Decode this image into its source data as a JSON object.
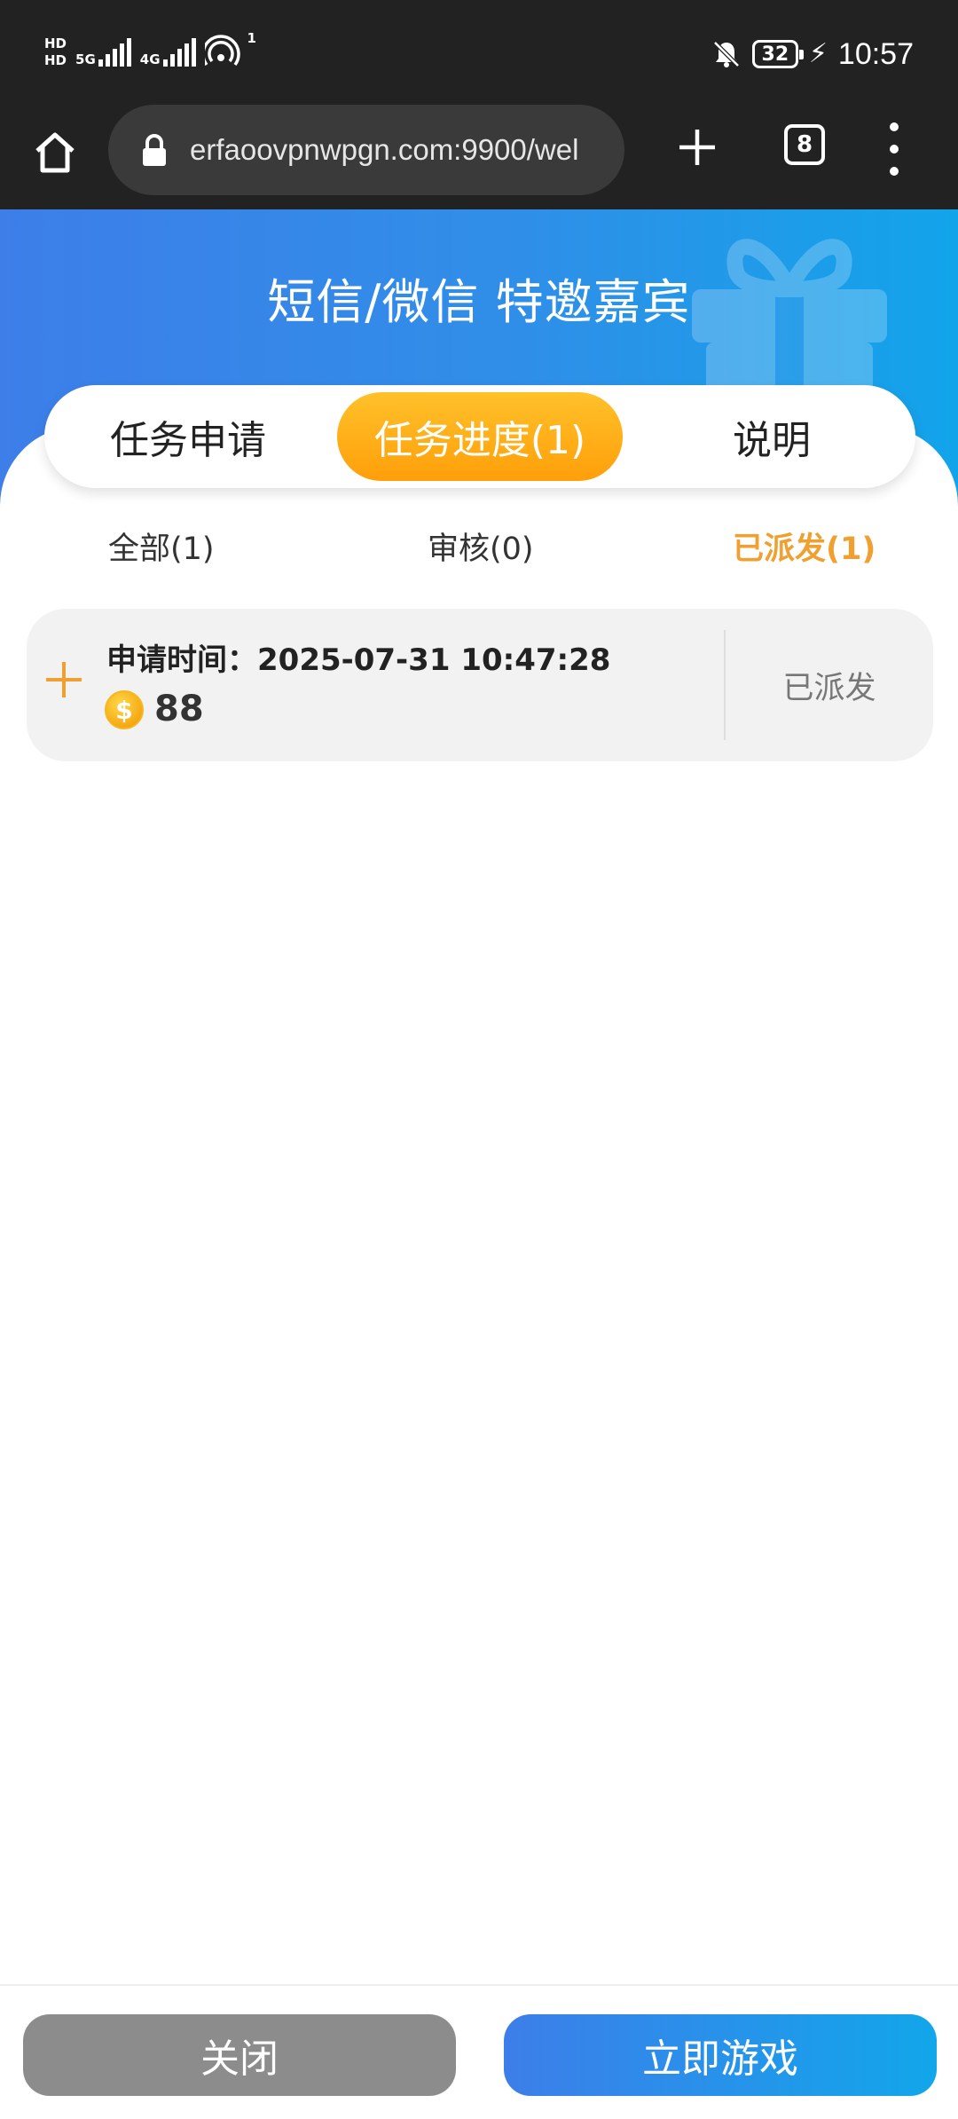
{
  "status_bar": {
    "hd_top": "HD",
    "hd_bottom": "HD",
    "net1": "5G",
    "net2": "4G",
    "hotspot_count": "1",
    "battery": "32",
    "time": "10:57"
  },
  "browser": {
    "url": "erfaoovpnwpgn.com:9900/wel",
    "tab_count": "8"
  },
  "hero": {
    "title": "短信/微信 特邀嘉宾"
  },
  "tabs": [
    {
      "label": "任务申请",
      "active": false
    },
    {
      "label": "任务进度(1)",
      "active": true
    },
    {
      "label": "说明",
      "active": false
    }
  ],
  "filters": [
    {
      "label": "全部(1)",
      "active": false
    },
    {
      "label": "审核(0)",
      "active": false
    },
    {
      "label": "已派发(1)",
      "active": true
    }
  ],
  "records": [
    {
      "time_label": "申请时间：2025-07-31 10:47:28",
      "amount": "88",
      "status": "已派发"
    }
  ],
  "footer": {
    "close_label": "关闭",
    "play_label": "立即游戏"
  },
  "colors": {
    "accent_orange": "#f0a030",
    "brand_blue": "#3d7ee9",
    "status_bar_bg": "#222222"
  }
}
